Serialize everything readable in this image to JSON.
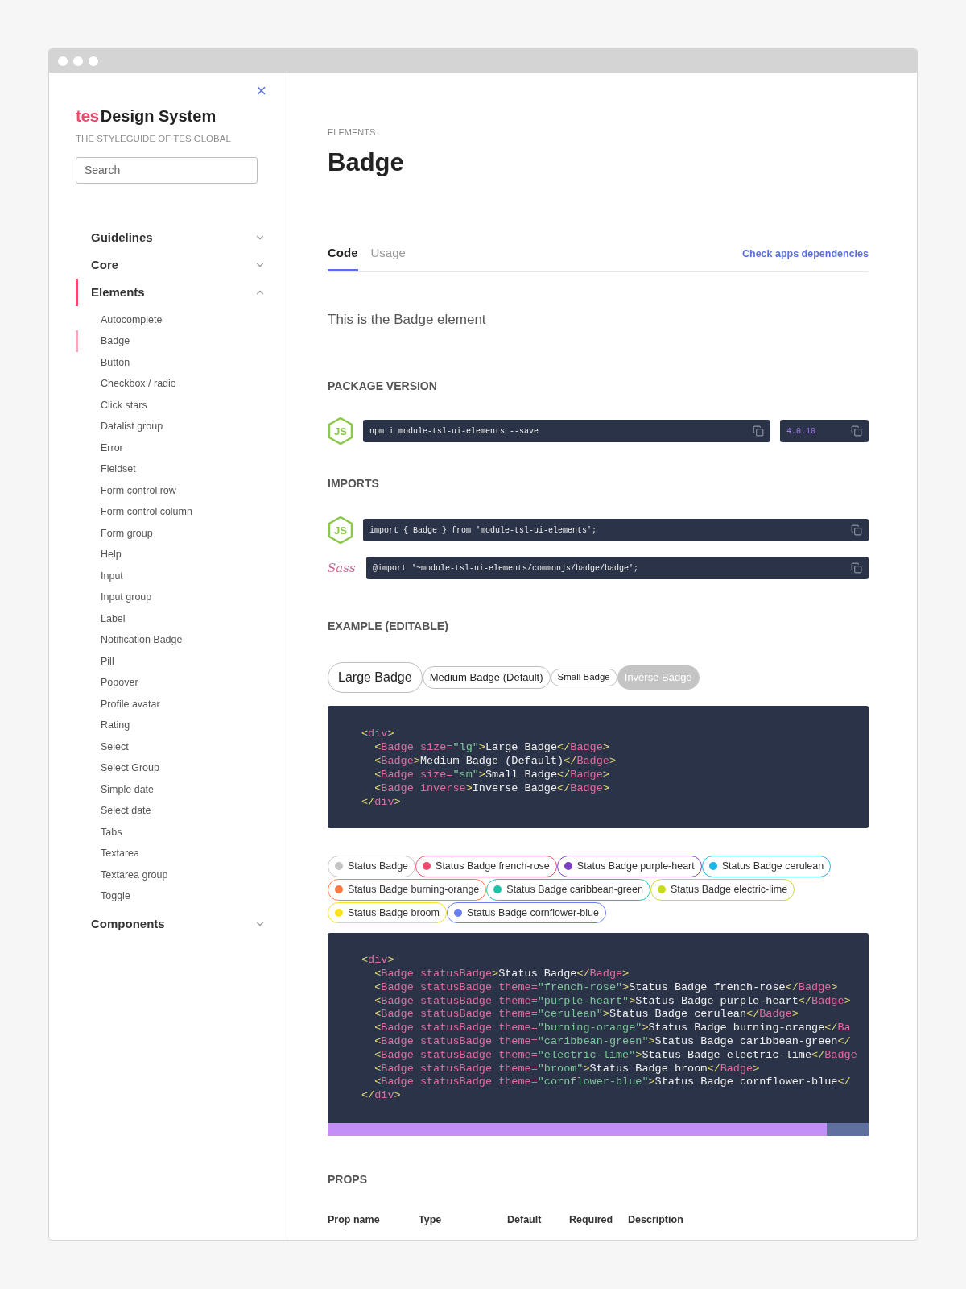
{
  "sidebar": {
    "close": "×",
    "brand": {
      "logo": "tes",
      "title": "Design System",
      "subtitle": "THE STYLEGUIDE OF TES GLOBAL"
    },
    "search": {
      "placeholder": "Search"
    },
    "nav": [
      {
        "label": "Guidelines",
        "expanded": false,
        "selected": false
      },
      {
        "label": "Core",
        "expanded": false,
        "selected": false
      },
      {
        "label": "Elements",
        "expanded": true,
        "selected": true,
        "children": [
          {
            "label": "Autocomplete",
            "selected": false
          },
          {
            "label": "Badge",
            "selected": true
          },
          {
            "label": "Button",
            "selected": false
          },
          {
            "label": "Checkbox / radio",
            "selected": false
          },
          {
            "label": "Click stars",
            "selected": false
          },
          {
            "label": "Datalist group",
            "selected": false
          },
          {
            "label": "Error",
            "selected": false
          },
          {
            "label": "Fieldset",
            "selected": false
          },
          {
            "label": "Form control row",
            "selected": false
          },
          {
            "label": "Form control column",
            "selected": false
          },
          {
            "label": "Form group",
            "selected": false
          },
          {
            "label": "Help",
            "selected": false
          },
          {
            "label": "Input",
            "selected": false
          },
          {
            "label": "Input group",
            "selected": false
          },
          {
            "label": "Label",
            "selected": false
          },
          {
            "label": "Notification Badge",
            "selected": false
          },
          {
            "label": "Pill",
            "selected": false
          },
          {
            "label": "Popover",
            "selected": false
          },
          {
            "label": "Profile avatar",
            "selected": false
          },
          {
            "label": "Rating",
            "selected": false
          },
          {
            "label": "Select",
            "selected": false
          },
          {
            "label": "Select Group",
            "selected": false
          },
          {
            "label": "Simple date",
            "selected": false
          },
          {
            "label": "Select date",
            "selected": false
          },
          {
            "label": "Tabs",
            "selected": false
          },
          {
            "label": "Textarea",
            "selected": false
          },
          {
            "label": "Textarea group",
            "selected": false
          },
          {
            "label": "Toggle",
            "selected": false
          }
        ]
      },
      {
        "label": "Components",
        "expanded": false,
        "selected": false
      }
    ]
  },
  "page": {
    "eyebrow": "ELEMENTS",
    "title": "Badge",
    "tabs": [
      {
        "label": "Code",
        "selected": true
      },
      {
        "label": "Usage",
        "selected": false
      }
    ],
    "dependencies_link": "Check apps dependencies",
    "intro": "This is the Badge element",
    "package_heading": "PACKAGE VERSION",
    "package_rows": [
      {
        "logo": "JS",
        "kind": "js",
        "command": "npm i module-tsl-ui-elements --save",
        "version": "4.0.10"
      }
    ],
    "imports_heading": "IMPORTS",
    "imports": [
      {
        "logo": "JS",
        "kind": "js",
        "code": "import { Badge } from 'module-tsl-ui-elements';"
      },
      {
        "logo": "Sass",
        "kind": "sass",
        "code": "@import '~module-tsl-ui-elements/commonjs/badge/badge';"
      }
    ],
    "example_heading": "EXAMPLE (EDITABLE)",
    "size_badges": [
      {
        "label": "Large Badge",
        "kind": "large"
      },
      {
        "label": "Medium Badge (Default)",
        "kind": "medium"
      },
      {
        "label": "Small Badge",
        "kind": "small"
      },
      {
        "label": "Inverse Badge",
        "kind": "inverse"
      }
    ],
    "code_1": [
      "<div>",
      "  <Badge size=\"lg\">Large Badge</Badge>",
      "  <Badge>Medium Badge (Default)</Badge>",
      "  <Badge size=\"sm\">Small Badge</Badge>",
      "  <Badge inverse>Inverse Badge</Badge>",
      "</div>"
    ],
    "status_badges": [
      {
        "label": "Status Badge",
        "color": "#c4c4c4"
      },
      {
        "label": "Status Badge french-rose",
        "color": "#ef4a6e"
      },
      {
        "label": "Status Badge purple-heart",
        "color": "#7a3fc4"
      },
      {
        "label": "Status Badge cerulean",
        "color": "#1bb4e6"
      },
      {
        "label": "Status Badge burning-orange",
        "color": "#ff7a45"
      },
      {
        "label": "Status Badge caribbean-green",
        "color": "#1ec4a8"
      },
      {
        "label": "Status Badge electric-lime",
        "color": "#c9dc1a"
      },
      {
        "label": "Status Badge broom",
        "color": "#fde125"
      },
      {
        "label": "Status Badge cornflower-blue",
        "color": "#6b7ff0"
      }
    ],
    "code_2": [
      "<div>",
      "  <Badge statusBadge>Status Badge</Badge>",
      "  <Badge statusBadge theme=\"french-rose\">Status Badge french-rose</Badge>",
      "  <Badge statusBadge theme=\"purple-heart\">Status Badge purple-heart</Badge>",
      "  <Badge statusBadge theme=\"cerulean\">Status Badge cerulean</Badge>",
      "  <Badge statusBadge theme=\"burning-orange\">Status Badge burning-orange</Ba",
      "  <Badge statusBadge theme=\"caribbean-green\">Status Badge caribbean-green</",
      "  <Badge statusBadge theme=\"electric-lime\">Status Badge electric-lime</Badge",
      "  <Badge statusBadge theme=\"broom\">Status Badge broom</Badge>",
      "  <Badge statusBadge theme=\"cornflower-blue\">Status Badge cornflower-blue</",
      "</div>"
    ],
    "props_heading": "PROPS",
    "props_columns": [
      "Prop name",
      "Type",
      "Default",
      "Required",
      "Description"
    ]
  }
}
